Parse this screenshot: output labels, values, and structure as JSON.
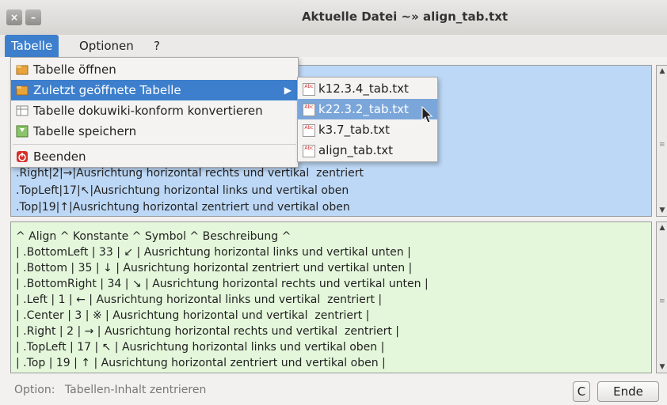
{
  "window": {
    "title": "Aktuelle Datei ~» align_tab.txt",
    "close_glyph": "×",
    "minimize_glyph": "–"
  },
  "menubar": {
    "items": [
      "Tabelle",
      "Optionen",
      "?"
    ]
  },
  "menu": {
    "items": [
      {
        "label": "Tabelle öffnen",
        "icon": "folder-icon"
      },
      {
        "label": "Zuletzt geöffnete Tabelle",
        "icon": "folder-icon",
        "submenu_arrow": "▶"
      },
      {
        "label": "Tabelle dokuwiki-konform konvertieren",
        "icon": "table-icon"
      },
      {
        "label": "Tabelle speichern",
        "icon": "save-icon"
      },
      {
        "label": "Beenden",
        "icon": "power-icon"
      }
    ]
  },
  "submenu": {
    "items": [
      "k12.3.4_tab.txt",
      "k22.3.2_tab.txt",
      "k3.7_tab.txt",
      "align_tab.txt"
    ],
    "icon_text": "Abc"
  },
  "area1": {
    "lines": [
      ".Right|2|→|Ausrichtung horizontal rechts und vertikal  zentriert",
      ".TopLeft|17|↖|Ausrichtung horizontal links und vertikal oben",
      ".Top|19|↑|Ausrichtung horizontal zentriert und vertikal oben"
    ],
    "partial_text": "zentriert"
  },
  "area2": {
    "lines": [
      "^ Align ^ Konstante ^ Symbol ^ Beschreibung ^",
      "| .BottomLeft | 33 | ↙ | Ausrichtung horizontal links und vertikal unten |",
      "| .Bottom | 35 | ↓ | Ausrichtung horizontal zentriert und vertikal unten |",
      "| .BottomRight | 34 | ↘ | Ausrichtung horizontal rechts und vertikal unten |",
      "| .Left | 1 | ← | Ausrichtung horizontal links und vertikal  zentriert |",
      "| .Center | 3 | ※ | Ausrichtung horizontal und vertikal  zentriert |",
      "| .Right | 2 | → | Ausrichtung horizontal rechts und vertikal  zentriert |",
      "| .TopLeft | 17 | ↖ | Ausrichtung horizontal links und vertikal oben |",
      "| .Top | 19 | ↑ | Ausrichtung horizontal zentriert und vertikal oben |"
    ]
  },
  "status": {
    "option_label": "Option:",
    "option_value": "Tabellen-Inhalt zentrieren",
    "c_button": "C",
    "end_button": "Ende"
  },
  "colors": {
    "highlight": "#3d7fcd",
    "area1_bg": "#bdd8f6",
    "area2_bg": "#e4f7db"
  }
}
